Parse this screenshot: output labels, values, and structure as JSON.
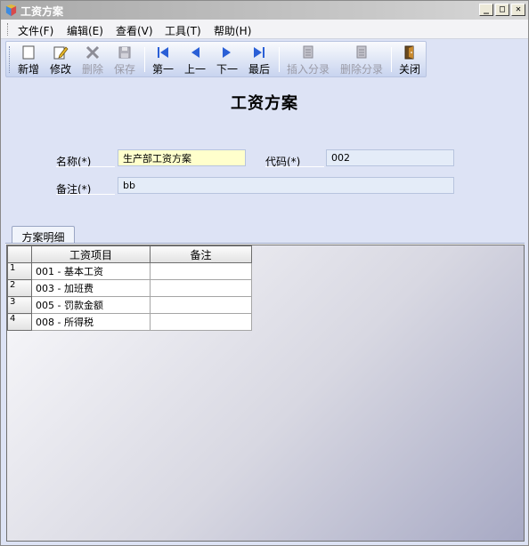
{
  "window": {
    "title": "工资方案",
    "minimize": "_",
    "maximize": "□",
    "close": "✕"
  },
  "menu": [
    {
      "label": "文件(F)",
      "icon": ""
    },
    {
      "label": "编辑(E)"
    },
    {
      "label": "查看(V)"
    },
    {
      "label": "工具(T)"
    },
    {
      "label": "帮助(H)"
    }
  ],
  "toolbar": [
    {
      "label": "新增",
      "icon": "new-doc-icon",
      "enabled": true
    },
    {
      "label": "修改",
      "icon": "edit-icon",
      "enabled": true
    },
    {
      "label": "删除",
      "icon": "delete-icon",
      "enabled": false
    },
    {
      "label": "保存",
      "icon": "save-icon",
      "enabled": false
    },
    {
      "label": "第一",
      "icon": "first-icon",
      "enabled": true
    },
    {
      "label": "上一",
      "icon": "prev-icon",
      "enabled": true
    },
    {
      "label": "下一",
      "icon": "next-icon",
      "enabled": true
    },
    {
      "label": "最后",
      "icon": "last-icon",
      "enabled": true
    },
    {
      "label": "插入分录",
      "icon": "insert-row-icon",
      "enabled": false
    },
    {
      "label": "删除分录",
      "icon": "delete-row-icon",
      "enabled": false
    },
    {
      "label": "关闭",
      "icon": "close-door-icon",
      "enabled": true
    }
  ],
  "form": {
    "title": "工资方案",
    "name_label": "名称(*)",
    "name_value": "生产部工资方案",
    "code_label": "代码(*)",
    "code_value": "002",
    "note_label": "备注(*)",
    "note_value": "bb"
  },
  "tab": {
    "label": "方案明细"
  },
  "grid": {
    "columns": [
      "工资项目",
      "备注"
    ],
    "rows": [
      {
        "num": "1",
        "item": "001 - 基本工资",
        "note": ""
      },
      {
        "num": "2",
        "item": "003 - 加班费",
        "note": ""
      },
      {
        "num": "3",
        "item": "005 - 罚款金额",
        "note": ""
      },
      {
        "num": "4",
        "item": "008 - 所得税",
        "note": ""
      }
    ]
  },
  "colors": {
    "accent_blue": "#2a5fd6",
    "required_field": "#ffffcc",
    "field_bg": "#e4ecf8"
  }
}
